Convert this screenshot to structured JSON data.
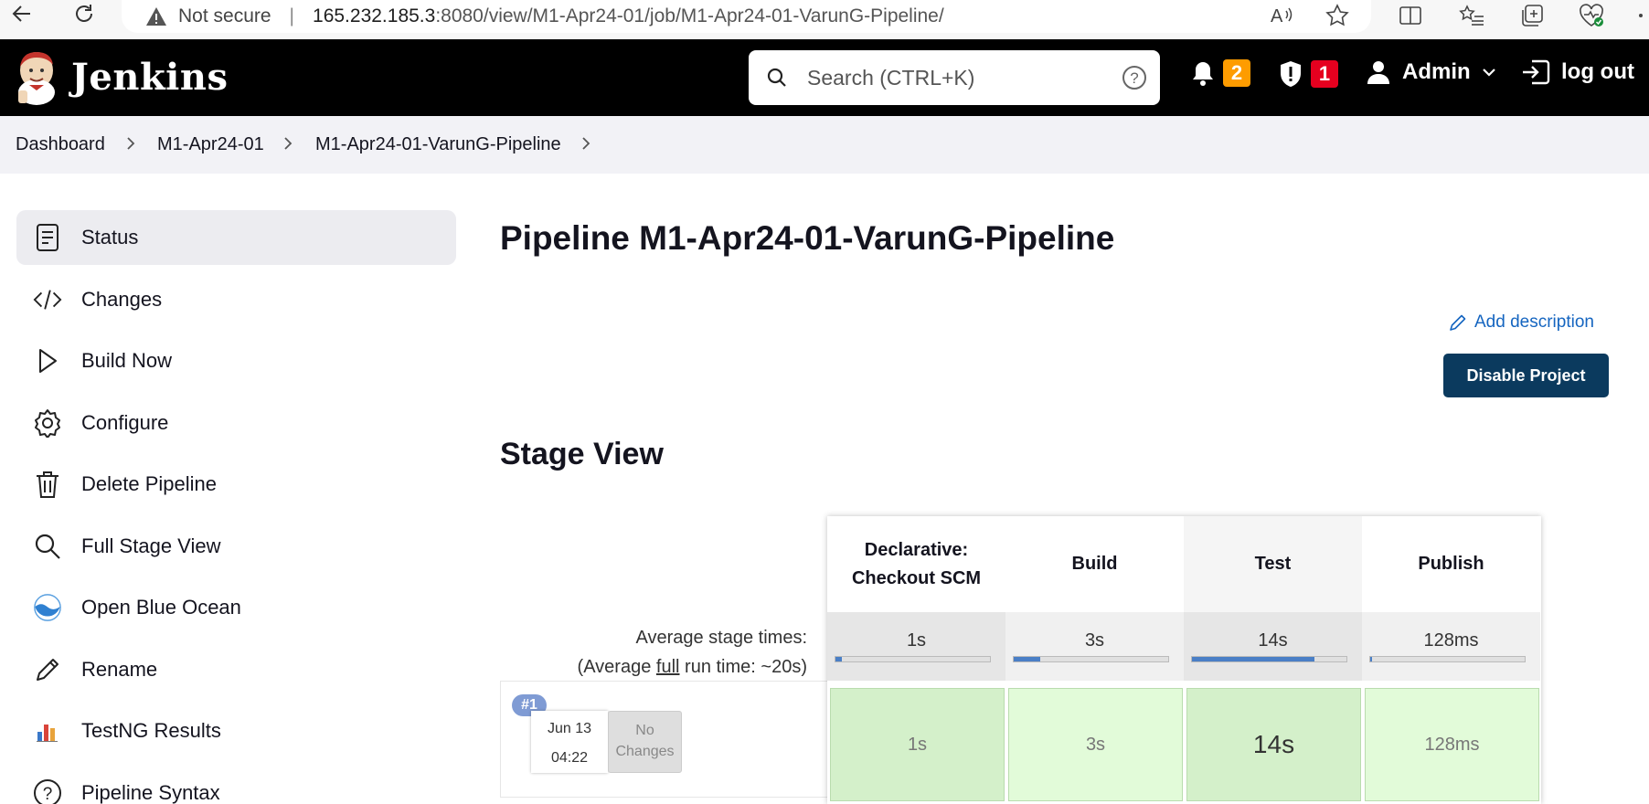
{
  "browser": {
    "security_label": "Not secure",
    "url_host": "165.232.185.3",
    "url_rest": ":8080/view/M1-Apr24-01/job/M1-Apr24-01-VarunG-Pipeline/"
  },
  "header": {
    "brand": "Jenkins",
    "search_placeholder": "Search (CTRL+K)",
    "notifications_count": "2",
    "security_count": "1",
    "user": "Admin",
    "logout": "log out"
  },
  "breadcrumb": [
    "Dashboard",
    "M1-Apr24-01",
    "M1-Apr24-01-VarunG-Pipeline"
  ],
  "sidebar": {
    "items": [
      {
        "label": "Status",
        "icon": "document-icon"
      },
      {
        "label": "Changes",
        "icon": "code-icon"
      },
      {
        "label": "Build Now",
        "icon": "play-icon"
      },
      {
        "label": "Configure",
        "icon": "gear-icon"
      },
      {
        "label": "Delete Pipeline",
        "icon": "trash-icon"
      },
      {
        "label": "Full Stage View",
        "icon": "search-icon"
      },
      {
        "label": "Open Blue Ocean",
        "icon": "blue-ocean-icon"
      },
      {
        "label": "Rename",
        "icon": "pencil-icon"
      },
      {
        "label": "TestNG Results",
        "icon": "bar-chart-icon"
      },
      {
        "label": "Pipeline Syntax",
        "icon": "help-icon"
      }
    ]
  },
  "main": {
    "title": "Pipeline M1-Apr24-01-VarunG-Pipeline",
    "add_description": "Add description",
    "disable_button": "Disable Project",
    "stage_view_heading": "Stage View"
  },
  "stage_view": {
    "stages": [
      "Declarative: Checkout SCM",
      "Build",
      "Test",
      "Publish"
    ],
    "stage_head_lines": [
      [
        "Declarative:",
        "Checkout SCM"
      ],
      [
        "Build"
      ],
      [
        "Test"
      ],
      [
        "Publish"
      ]
    ],
    "avg_times": [
      "1s",
      "3s",
      "14s",
      "128ms"
    ],
    "avg_fill_fraction": [
      0.04,
      0.17,
      0.79,
      0.01
    ],
    "avg_label_1": "Average stage times:",
    "avg_label_2a": "(Average ",
    "avg_label_2b": "full",
    "avg_label_2c": " run time: ~20s)",
    "run": {
      "number": "#1",
      "date": "Jun 13",
      "time": "04:22",
      "changes_line1": "No",
      "changes_line2": "Changes",
      "durations": [
        "1s",
        "3s",
        "14s",
        "128ms"
      ]
    }
  },
  "colors": {
    "header_bg": "#000000",
    "disable_button_bg": "#0b3a5e",
    "success_cell": "#e2fbd9",
    "notification_badge": "#fe9c00",
    "security_badge": "#e6001f"
  }
}
